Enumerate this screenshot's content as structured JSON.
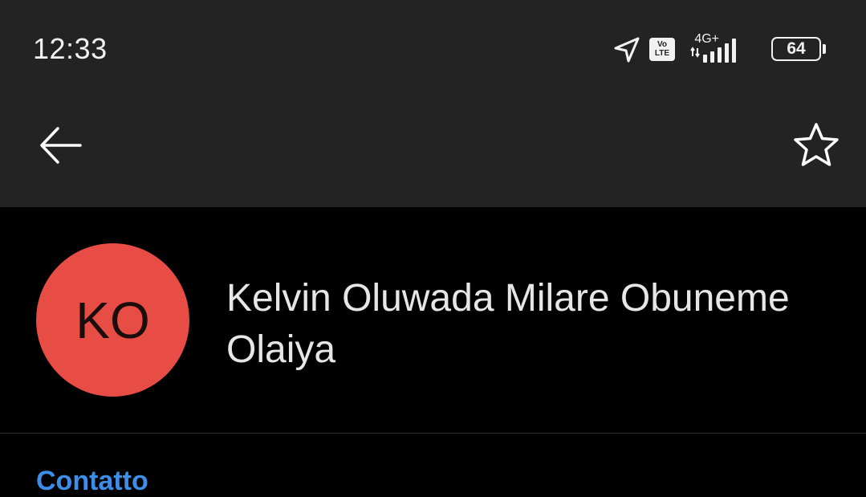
{
  "status_bar": {
    "time": "12:33",
    "icons": [
      "location-arrow-icon",
      "volte-icon",
      "signal-icon",
      "battery-icon"
    ],
    "volte_line1": "Vo",
    "volte_line2": "LTE",
    "network_type": "4G+",
    "battery_percent": "64"
  },
  "app_bar": {
    "back_icon": "arrow-left-icon",
    "favorite_icon": "star-outline-icon"
  },
  "contact": {
    "initials": "KO",
    "avatar_color": "#e74c45",
    "name": "Kelvin Oluwada Milare Obuneme Olaiya"
  },
  "sections": {
    "contact_label": "Contatto"
  },
  "colors": {
    "background": "#000000",
    "bar_background": "#232323",
    "accent": "#3d8ee8"
  }
}
